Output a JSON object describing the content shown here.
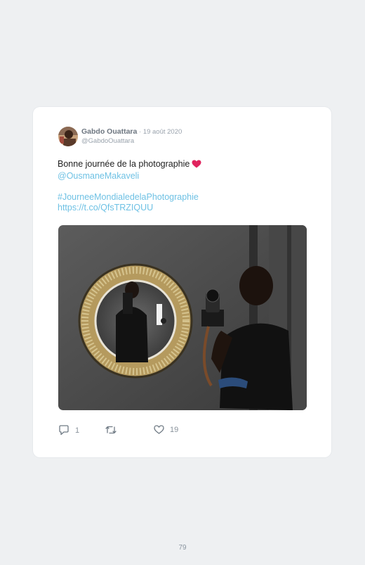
{
  "tweet": {
    "author_name": "Gabdo Ouattara",
    "separator": " · ",
    "date": "19 août 2020",
    "handle": "@GabdoOuattara",
    "text": "Bonne journée de la photographie",
    "mention": "@OusmaneMakaveli",
    "hashtag": "#JourneeMondialedelaPhotographie",
    "link": "https://t.co/QfsTRZIQUU",
    "replies": "1",
    "likes": "19"
  },
  "icons": {
    "heart_emoji": "red-heart",
    "reply": "reply-icon",
    "retweet": "retweet-icon",
    "like": "like-icon"
  },
  "colors": {
    "background": "#eef0f2",
    "card": "#ffffff",
    "link": "#6ec1e4",
    "heart": "#e0245e"
  },
  "page_number": "79"
}
